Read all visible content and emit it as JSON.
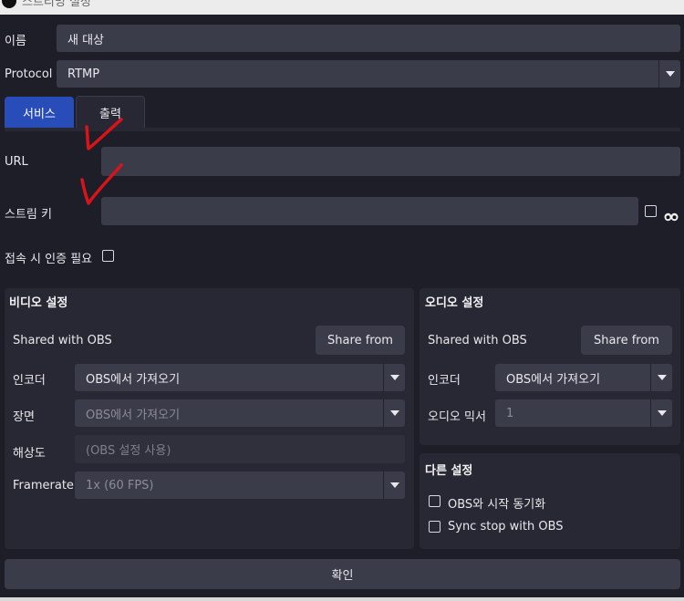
{
  "window": {
    "title": "스트리밍 설정"
  },
  "form": {
    "name_label": "이름",
    "name_value": "새 대상",
    "protocol_label": "Protocol",
    "protocol_value": "RTMP"
  },
  "tabs": [
    {
      "label": "서비스",
      "active": true
    },
    {
      "label": "출력",
      "active": false
    }
  ],
  "service": {
    "url_label": "URL",
    "url_value": "",
    "stream_key_label": "스트림 키",
    "stream_key_value": "",
    "show_key_icon": "eye-icon",
    "auth_label": "접속 시 인증 필요"
  },
  "video": {
    "title": "비디오 설정",
    "shared_label": "Shared with OBS",
    "share_button": "Share from",
    "encoder_label": "인코더",
    "encoder_value": "OBS에서 가져오기",
    "scene_label": "장면",
    "scene_value": "OBS에서 가져오기",
    "resolution_label": "해상도",
    "resolution_placeholder": "(OBS 설정 사용)",
    "framerate_label": "Framerate",
    "framerate_value": "1x (60 FPS)"
  },
  "audio": {
    "title": "오디오 설정",
    "shared_label": "Shared with OBS",
    "share_button": "Share from",
    "encoder_label": "인코더",
    "encoder_value": "OBS에서 가져오기",
    "mixer_label": "오디오 믹서",
    "mixer_value": "1"
  },
  "other": {
    "title": "다른 설정",
    "sync_start_label": "OBS와 시작 동기화",
    "sync_stop_label": "Sync stop with OBS"
  },
  "confirm_button": "확인",
  "colors": {
    "background": "#1d1e27",
    "panel": "#272833",
    "field": "#3b3c4a",
    "tab_active": "#284cb8",
    "annotation_red": "#d8141a"
  }
}
